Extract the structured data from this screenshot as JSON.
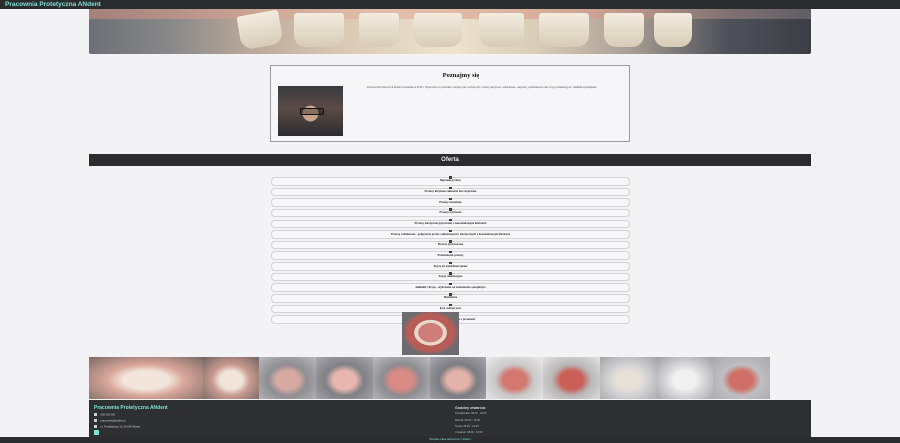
{
  "header": {
    "brand": "Pracownia Protetyczna ANdent"
  },
  "about": {
    "title": "Poznajmy się",
    "text": "Pracownia Protetyczna ANdent powstała w 2015 r. Wykonuje-my wszelkie rodzaje prac ruchomych: protezy akrylowe, szkieletowe, naprawy, podścielenia oraz szyny relaksacyjne i nakładki wybielające."
  },
  "offer": {
    "title": "Oferta",
    "items": [
      "Naprawa protezy",
      "Protezy akrylowe całkowite lub częściowe",
      "Protezy acetalowe",
      "Protezy nylonowe",
      "Protezy elastyczne (nylonowe) z bezmetalowymi klamrami",
      "Protezy szkieletowe - połączenie protez szkieletowych i elastycznych z bezmetalowymi klamrami",
      "Protezy tymczasowe",
      "Podścielenie protezy",
      "Szyny do wybielania zębów",
      "Szyny relaksacyjne",
      "Nakładki i Szyny - wykonanie na zamówienie specjalnym",
      "Wybielanie",
      "Inne rodzaje prac",
      "Usługi dodatkowe związane z protezami"
    ]
  },
  "gallery": {
    "items": [
      "smile-photo",
      "denture-photo",
      "partial-denture-photo",
      "partial-denture-photo-2",
      "skeleton-denture-photo",
      "acrylic-denture-photo",
      "full-denture-photo",
      "model-photo",
      "bleaching-tray-photo",
      "denture-photo-2",
      "partial-denture-photo-3"
    ]
  },
  "footer": {
    "title": "Pracownia Protetyczna ANdent",
    "phone": "600 000 000",
    "email": "pracownia@andent.pl",
    "address": "ul. Przykładowa 10, 00-000 Miasto",
    "hours_title": "Godziny otwarcia:",
    "hours": [
      "Poniedziałek: 08:00 - 16:00",
      "Wtorek: 08:00 - 16:00",
      "Środa: 08:00 - 16:00",
      "Czwartek: 08:00 - 16:00"
    ]
  },
  "copyright": "Wszelkie prawa zastrzeżone © ANdent",
  "colors": {
    "accent": "#7fe3d4",
    "bar": "#2b2c2e"
  }
}
